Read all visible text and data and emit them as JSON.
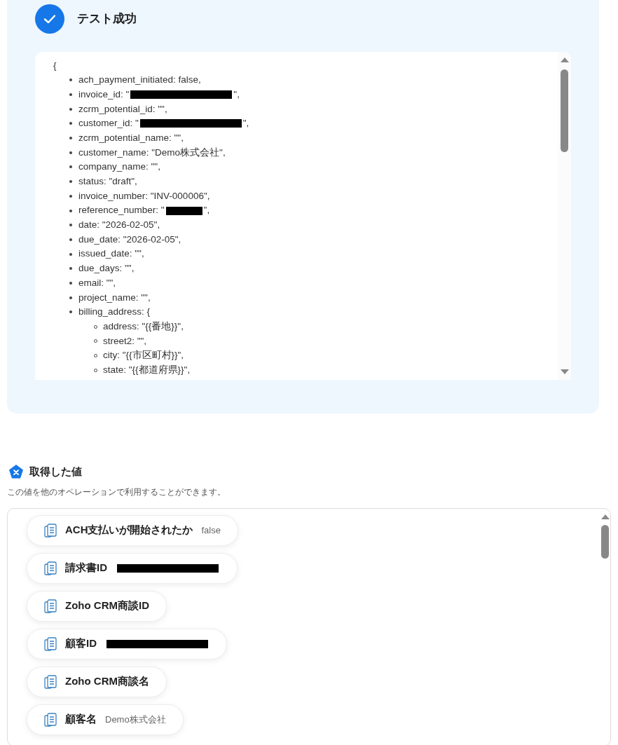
{
  "result": {
    "title": "テスト成功",
    "success": true
  },
  "json_view": {
    "open_brace": "{",
    "lines": [
      {
        "text": "ach_payment_initiated: false,"
      },
      {
        "text": "invoice_id: \"",
        "redacted": true,
        "after": "\","
      },
      {
        "text": "zcrm_potential_id: \"\","
      },
      {
        "text": "customer_id: \"",
        "redacted": true,
        "after": "\","
      },
      {
        "text": "zcrm_potential_name: \"\","
      },
      {
        "text": "customer_name: \"Demo株式会社\","
      },
      {
        "text": "company_name: \"\","
      },
      {
        "text": "status: \"draft\","
      },
      {
        "text": "invoice_number: \"INV-000006\","
      },
      {
        "text": "reference_number: \"",
        "redacted": true,
        "short": true,
        "after": "\","
      },
      {
        "text": "date: \"2026-02-05\","
      },
      {
        "text": "due_date: \"2026-02-05\","
      },
      {
        "text": "issued_date: \"\","
      },
      {
        "text": "due_days: \"\","
      },
      {
        "text": "email: \"\","
      },
      {
        "text": "project_name: \"\","
      },
      {
        "text": "billing_address: {",
        "children": [
          {
            "text": "address: \"{{番地}}\","
          },
          {
            "text": "street2: \"\","
          },
          {
            "text": "city: \"{{市区町村}}\","
          },
          {
            "text": "state: \"{{都道府県}}\","
          }
        ]
      }
    ]
  },
  "outputs": {
    "title": "取得した値",
    "description": "この値を他のオペレーションで利用することができます。",
    "items": [
      {
        "label": "ACH支払いが開始されたか",
        "value": "false"
      },
      {
        "label": "請求書ID",
        "redacted": true
      },
      {
        "label": "Zoho CRM商談ID"
      },
      {
        "label": "顧客ID",
        "redacted": true
      },
      {
        "label": "Zoho CRM商談名"
      },
      {
        "label": "顧客名",
        "value": "Demo株式会社"
      }
    ]
  }
}
